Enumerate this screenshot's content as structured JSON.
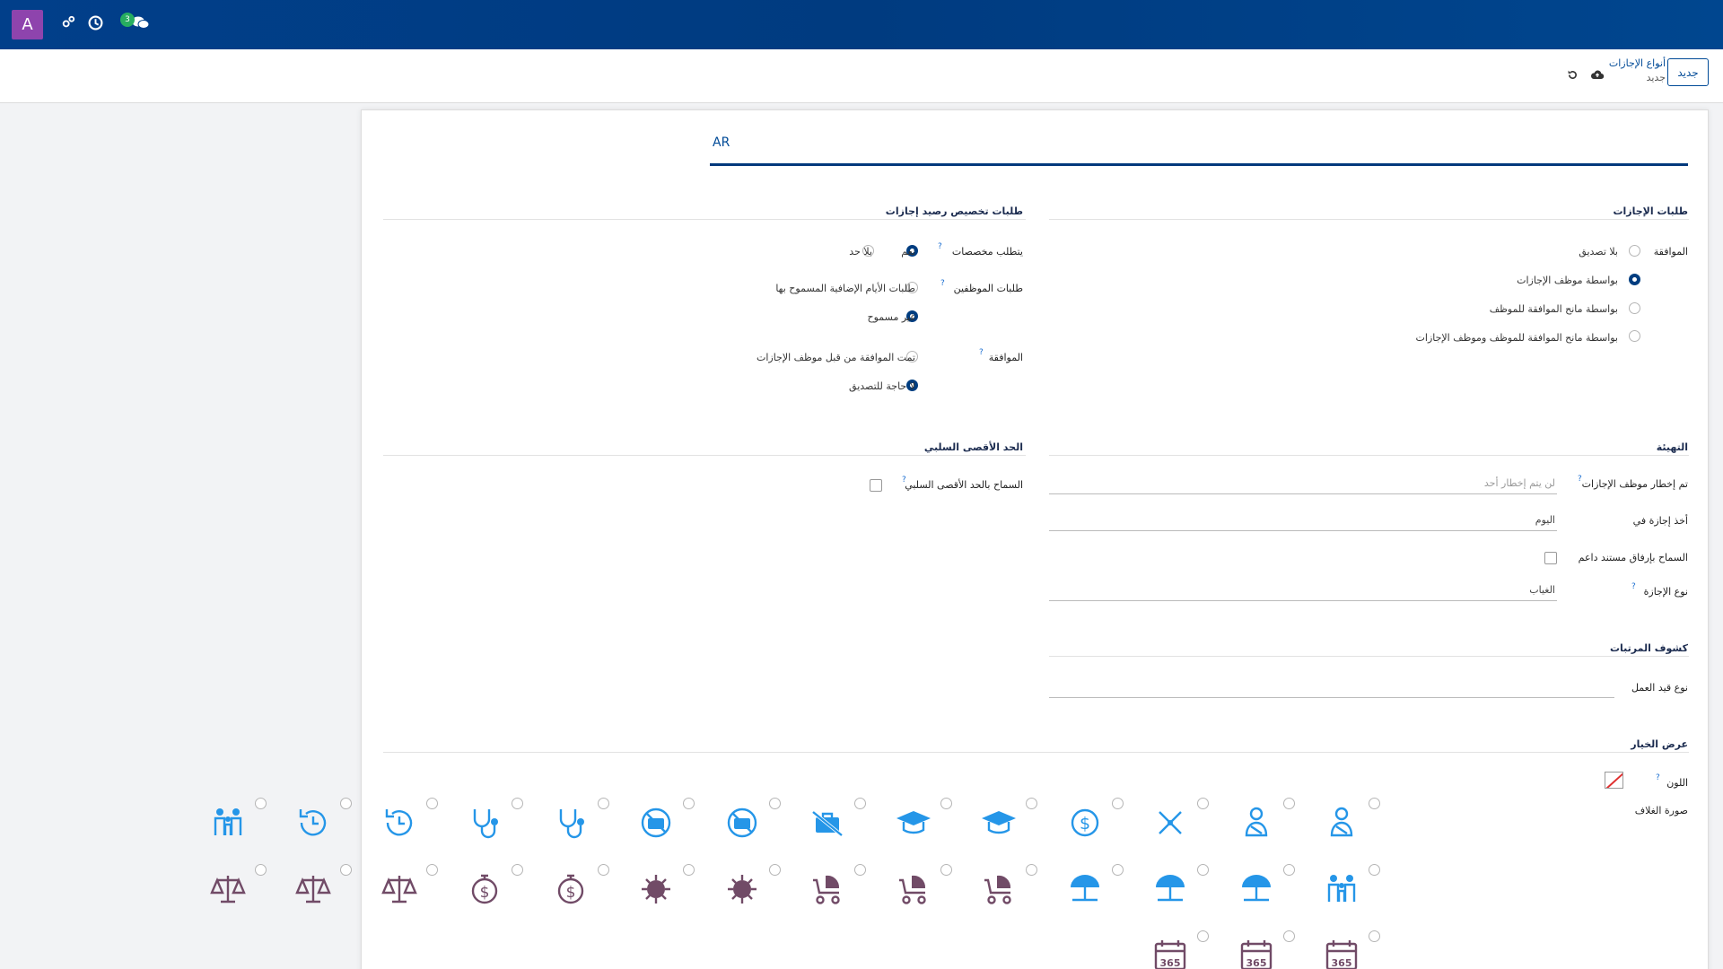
{
  "topbar": {
    "avatar_letter": "A",
    "chat_count": "3",
    "icons": [
      "cog-share-icon",
      "clock-icon",
      "chat-icon"
    ]
  },
  "control_panel": {
    "new_button": "جديد",
    "breadcrumb": "أنواع الإجازات",
    "breadcrumb_current": "جديد"
  },
  "tabs": {
    "lang": "AR"
  },
  "leave_requests": {
    "title": "طلبات الإجازات",
    "approval_label": "الموافقة",
    "options": [
      {
        "label": "بلا تصديق",
        "selected": false
      },
      {
        "label": "بواسطة موظف الإجازات",
        "selected": true
      },
      {
        "label": "بواسطة مانح الموافقة للموظف",
        "selected": false
      },
      {
        "label": "بواسطة مانح الموافقة للموظف وموظف الإجازات",
        "selected": false
      }
    ]
  },
  "allocation_requests": {
    "title": "طلبات تخصيص رصيد إجازات",
    "requires_label": "يتطلب مخصصات",
    "requires_yes": "نعم",
    "requires_no": "بلا حد",
    "employee_requests_label": "طلبات الموظفين",
    "employee_opt1": "طلبات الأيام الإضافية المسموح بها",
    "employee_opt2": "غير مسموح",
    "approval_label": "الموافقة",
    "approval_opt1": "تمت الموافقة من قبل موظف الإجازات",
    "approval_opt2": "لا حاجة للتصديق"
  },
  "config": {
    "title": "التهيئة",
    "notify_label": "تم إخطار موظف الإجازات",
    "notify_placeholder": "لن يتم إخطار أحد",
    "take_leave_label": "أخذ إجازة في",
    "take_leave_value": "اليوم",
    "attach_label": "السماح بإرفاق مستند داعم",
    "kind_label": "نوع الإجازة",
    "kind_value": "الغياب"
  },
  "negative": {
    "title": "الحد الأقصى السلبي",
    "allow_label": "السماح بالحد الأقصى السلبي"
  },
  "payslips": {
    "title": "كشوف المرتبات",
    "work_entry_label": "نوع قيد العمل"
  },
  "display": {
    "title": "عرض الخيار",
    "color_label": "اللون",
    "cover_label": "صورة الغلاف",
    "colors": {
      "blue": "#2596e8",
      "purple": "#714b67"
    },
    "icons_row1": [
      "user-sling-icon",
      "user-sling-outline-icon",
      "scissor-bone-icon",
      "dollar-circle-icon",
      "graduation-cap-icon",
      "graduation-cap-outline-icon",
      "no-suitcase-icon",
      "no-briefcase-circle-icon",
      "no-briefcase-circle-outline-icon",
      "stethoscope-icon",
      "stethoscope-outline-icon",
      "time-back-icon",
      "time-back-outline-icon",
      "family-icon"
    ],
    "icons_row2": [
      "family-outline-icon",
      "beach-umbrella-icon",
      "beach-umbrella-alt-icon",
      "beach-umbrella-outline-icon",
      "baby-carriage-icon",
      "baby-carriage-alt-icon",
      "baby-carriage-outline-icon",
      "virus-icon",
      "virus-outline-icon",
      "dollar-stopwatch-icon",
      "dollar-stopwatch-outline-icon",
      "justice-scale-icon",
      "justice-scale-alt-icon",
      "justice-scale-outline-icon"
    ],
    "icons_row3": [
      "calendar-365-icon",
      "calendar-365-alt-icon",
      "calendar-365-outline-icon"
    ],
    "calendar_text": "365"
  }
}
